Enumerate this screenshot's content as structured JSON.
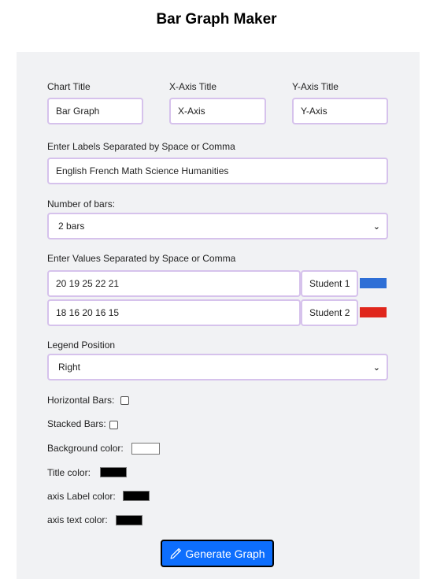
{
  "page": {
    "title": "Bar Graph Maker"
  },
  "form": {
    "chart_title_label": "Chart Title",
    "chart_title_value": "Bar Graph",
    "x_axis_label": "X-Axis Title",
    "x_axis_value": "X-Axis",
    "y_axis_label": "Y-Axis Title",
    "y_axis_value": "Y-Axis",
    "labels_label": "Enter Labels Separated by Space or Comma",
    "labels_value": "English French Math Science Humanities",
    "num_bars_label": "Number of bars:",
    "num_bars_value": "2 bars",
    "values_label": "Enter Values Separated by Space or Comma",
    "series": [
      {
        "values": "20 19 25 22 21",
        "name": "Student 1",
        "color": "#2e6fd6"
      },
      {
        "values": "18 16 20 16 15",
        "name": "Student 2",
        "color": "#e0261c"
      }
    ],
    "legend_position_label": "Legend Position",
    "legend_position_value": "Right",
    "horizontal_bars_label": "Horizontal Bars:",
    "horizontal_bars_checked": false,
    "stacked_bars_label": "Stacked Bars:",
    "stacked_bars_checked": false,
    "background_color_label": "Background color:",
    "background_color": "#ffffff",
    "title_color_label": "Title color:",
    "title_color": "#000000",
    "axis_label_color_label": "axis Label color:",
    "axis_label_color": "#000000",
    "axis_text_color_label": "axis text color:",
    "axis_text_color": "#000000",
    "generate_button_label": "Generate Graph",
    "generate_button_icon": "pencil-icon",
    "button_color": "#0d6efd"
  }
}
